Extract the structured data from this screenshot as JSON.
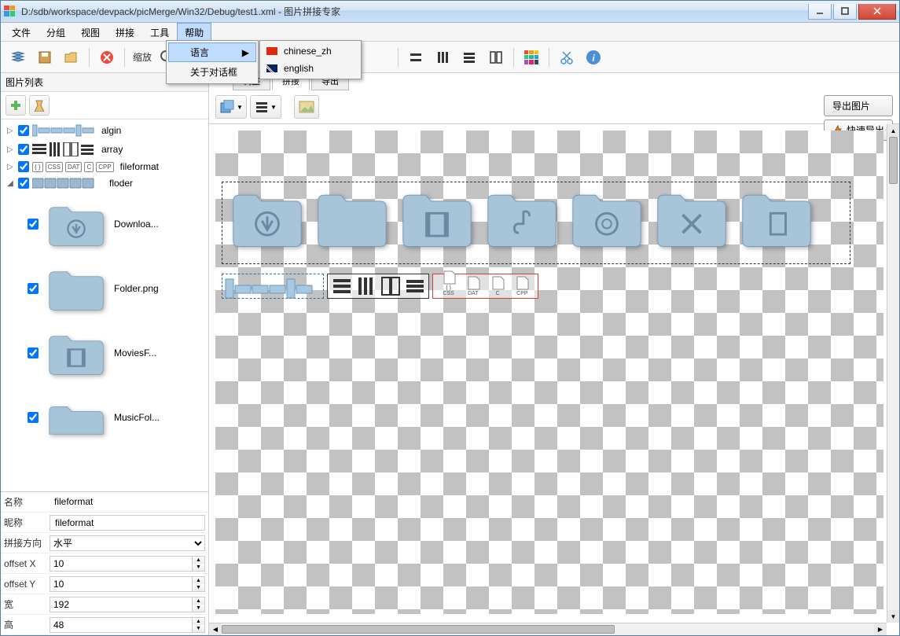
{
  "titlebar": {
    "path": "D:/sdb/workspace/devpack/picMerge/Win32/Debug/test1.xml",
    "appname": "图片拼接专家"
  },
  "menu": {
    "file": "文件",
    "group": "分组",
    "view": "视图",
    "merge": "拼接",
    "tool": "工具",
    "help": "帮助"
  },
  "help_menu": {
    "language": "语言",
    "about": "关于对话框"
  },
  "lang_menu": {
    "chinese": "chinese_zh",
    "english": "english"
  },
  "toolbar": {
    "zoom": "缩放"
  },
  "left": {
    "header": "图片列表",
    "tree": {
      "algin": "algin",
      "array": "array",
      "fileformat": "fileformat",
      "floder": "floder"
    },
    "thumbs": {
      "downloads": "Downloa...",
      "folder": "Folder.png",
      "movies": "MoviesF...",
      "music": "MusicFol..."
    }
  },
  "props": {
    "name_label": "名称",
    "name_value": "fileformat",
    "nick_label": "昵称",
    "nick_value": "fileformat",
    "dir_label": "拼接方向",
    "dir_value": "水平",
    "ox_label": "offset X",
    "ox_value": "10",
    "oy_label": "offset Y",
    "oy_value": "10",
    "w_label": "宽",
    "w_value": "192",
    "h_label": "高",
    "h_value": "48"
  },
  "right": {
    "tabs": {
      "adjust": "调整",
      "merge": "拼接",
      "export": "导出"
    },
    "export_btn": "导出图片",
    "quick_export_btn": "快速导出"
  },
  "fileformats": [
    "CSS",
    "DAT",
    "C",
    "CPP"
  ]
}
